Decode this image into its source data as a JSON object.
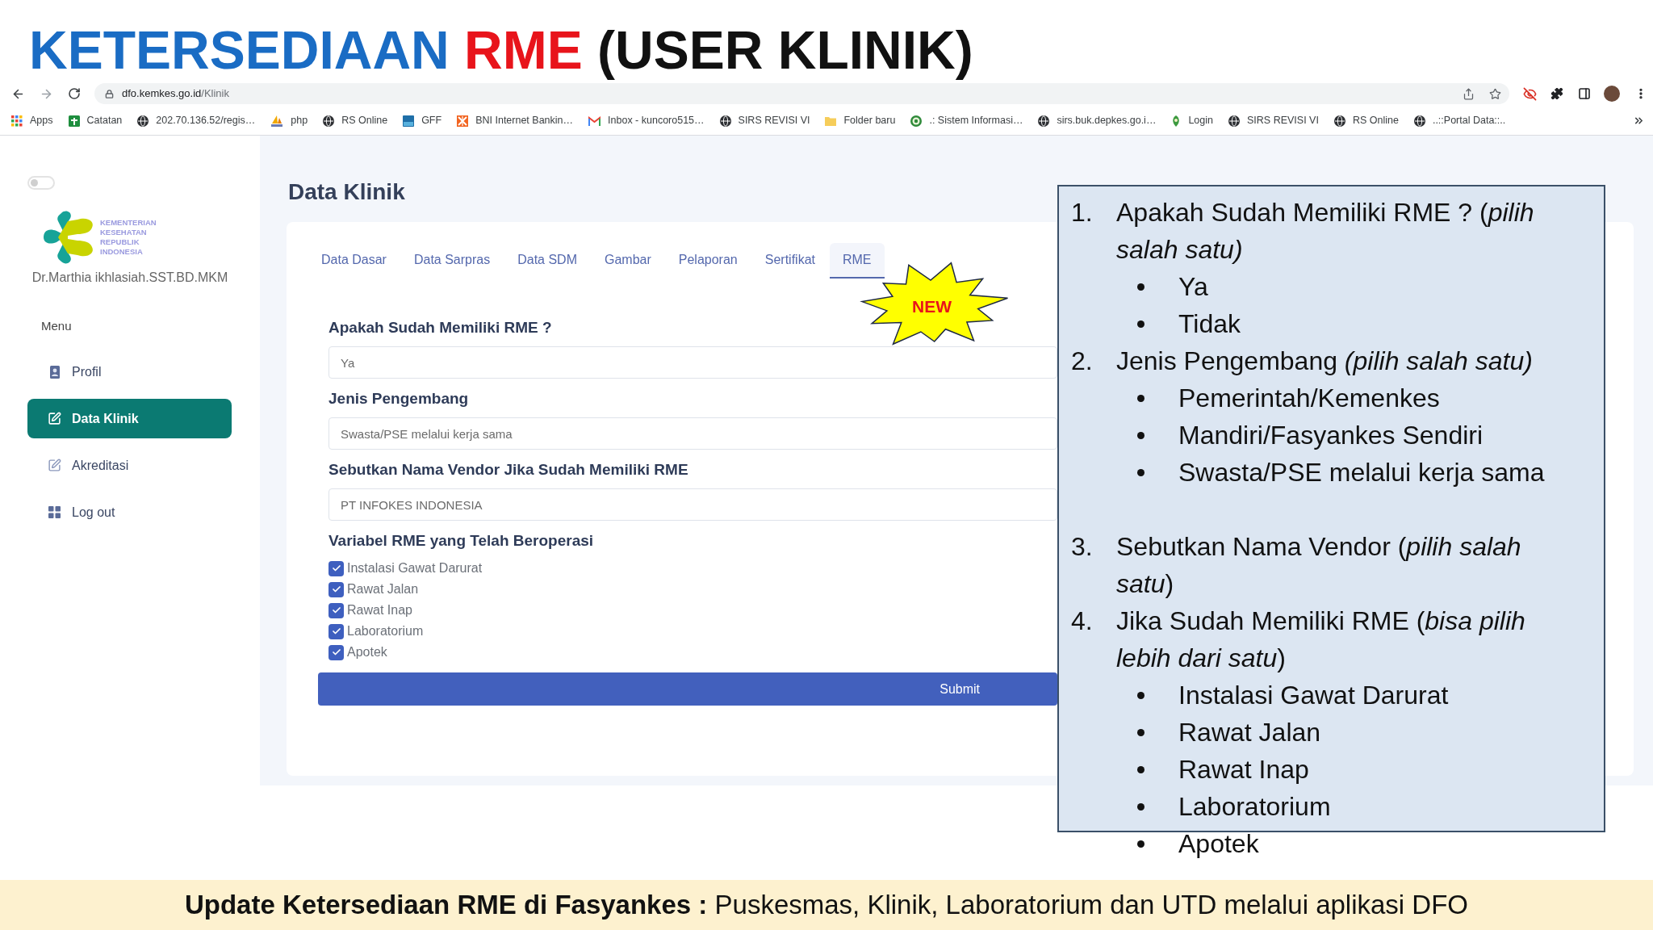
{
  "slide_title": [
    {
      "text": "KETERSEDIAAN",
      "color": "#1a6cc4"
    },
    {
      "text": "RME",
      "color": "#e8141b"
    },
    {
      "text": "(USER KLINIK)",
      "color": "#111111"
    }
  ],
  "browser": {
    "address_bar": {
      "host": "dfo.kemkes.go.id",
      "path": "/Klinik"
    },
    "bookmarks": [
      {
        "label": "Apps"
      },
      {
        "label": "Catatan"
      },
      {
        "label": "202.70.136.52/regis…"
      },
      {
        "label": "php"
      },
      {
        "label": "RS Online"
      },
      {
        "label": "GFF"
      },
      {
        "label": "BNI Internet Bankin…"
      },
      {
        "label": "Inbox - kuncoro515…"
      },
      {
        "label": "SIRS REVISI VI"
      },
      {
        "label": "Folder baru"
      },
      {
        "label": ".: Sistem Informasi…"
      },
      {
        "label": "sirs.buk.depkes.go.i…"
      },
      {
        "label": "Login"
      },
      {
        "label": "SIRS REVISI VI"
      },
      {
        "label": "RS Online"
      },
      {
        "label": "..::Portal Data::.."
      }
    ]
  },
  "sidebar": {
    "dark_mode_toggle": {
      "on": false
    },
    "logo_text": "KEMENTERIAN KESEHATAN REPUBLIK INDONESIA",
    "user_name": "Dr.Marthia ikhlasiah.SST.BD.MKM",
    "menu_heading": "Menu",
    "items": [
      {
        "label": "Profil",
        "selected": false
      },
      {
        "label": "Data Klinik",
        "selected": true
      },
      {
        "label": "Akreditasi",
        "selected": false
      },
      {
        "label": "Log out",
        "selected": false
      }
    ]
  },
  "main": {
    "title": "Data Klinik",
    "tabs": [
      {
        "label": "Data Dasar",
        "selected": false
      },
      {
        "label": "Data Sarpras",
        "selected": false
      },
      {
        "label": "Data SDM",
        "selected": false
      },
      {
        "label": "Gambar",
        "selected": false
      },
      {
        "label": "Pelaporan",
        "selected": false
      },
      {
        "label": "Sertifikat",
        "selected": false
      },
      {
        "label": "RME",
        "selected": true
      }
    ],
    "badge": "NEW",
    "form": {
      "fields": [
        {
          "label": "Apakah Sudah Memiliki RME ?",
          "value": "Ya"
        },
        {
          "label": "Jenis Pengembang",
          "value": "Swasta/PSE melalui kerja sama"
        },
        {
          "label": "Sebutkan Nama Vendor Jika Sudah Memiliki RME",
          "value": "PT INFOKES INDONESIA"
        }
      ],
      "checklist_label": "Variabel RME yang Telah Beroperasi",
      "checklist": [
        {
          "label": "Instalasi Gawat Darurat",
          "checked": true
        },
        {
          "label": "Rawat Jalan",
          "checked": true
        },
        {
          "label": "Rawat Inap",
          "checked": true
        },
        {
          "label": "Laboratorium",
          "checked": true
        },
        {
          "label": "Apotek",
          "checked": true
        }
      ],
      "submit": "Submit"
    }
  },
  "instructions_box": {
    "items": [
      {
        "number": "1.",
        "text": "Apakah Sudah Memiliki RME ? (*pilih salah satu)*",
        "options": [
          "Ya",
          "Tidak"
        ]
      },
      {
        "number": "2.",
        "text": "Jenis Pengembang *(pilih salah satu)*",
        "options": [
          "Pemerintah/Kemenkes",
          "Mandiri/Fasyankes Sendiri",
          "Swasta/PSE melalui kerja sama"
        ]
      },
      {
        "number": "3.",
        "text": "Sebutkan Nama Vendor (*pilih salah satu*)"
      },
      {
        "number": "4.",
        "text": "Jika Sudah Memiliki RME (*bisa pilih lebih dari satu*)",
        "options": [
          "Instalasi Gawat Darurat",
          "Rawat Jalan",
          "Rawat Inap",
          "Laboratorium",
          "Apotek"
        ]
      }
    ]
  },
  "footer": "**Update Ketersediaan RME di Fasyankes :** Puskesmas, Klinik, Laboratorium dan UTD melalui aplikasi DFO"
}
